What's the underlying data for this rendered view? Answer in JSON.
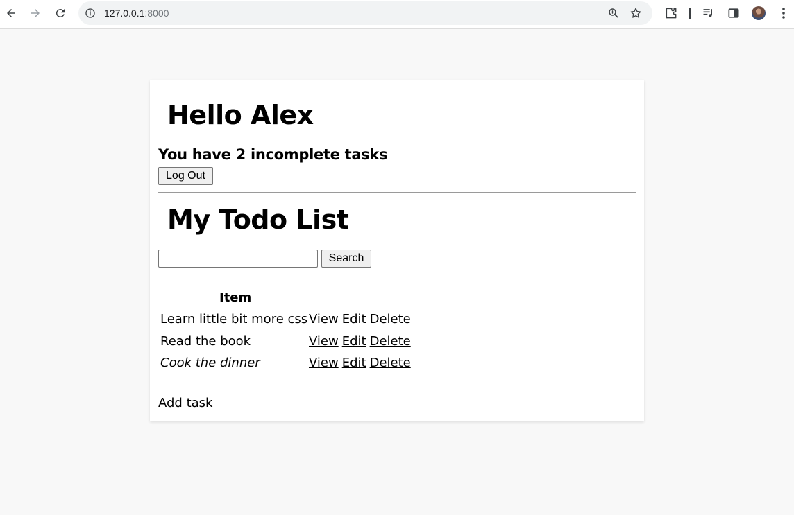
{
  "browser": {
    "url_host": "127.0.0.1",
    "url_port": ":8000",
    "icons": [
      "back-icon",
      "forward-icon",
      "reload-icon",
      "site-info-icon",
      "zoom-icon",
      "bookmark-star-icon",
      "extensions-icon",
      "media-control-icon",
      "side-panel-icon",
      "profile-avatar",
      "menu-dots-icon"
    ]
  },
  "page": {
    "greeting": "Hello Alex",
    "incomplete_summary": "You have 2 incomplete tasks",
    "logout_label": "Log Out",
    "todo_title": "My Todo List",
    "search_value": "",
    "search_label": "Search",
    "table_header": "Item",
    "tasks": [
      {
        "title": "Learn little bit more css",
        "completed": false,
        "view": "View",
        "edit": "Edit",
        "delete": "Delete"
      },
      {
        "title": "Read the book",
        "completed": false,
        "view": "View",
        "edit": "Edit",
        "delete": "Delete"
      },
      {
        "title": "Cook the dinner",
        "completed": true,
        "view": "View",
        "edit": "Edit",
        "delete": "Delete"
      }
    ],
    "add_task_label": "Add task"
  },
  "colors": {
    "page_background": "#f8f8f8",
    "card_background": "#ffffff",
    "button_background": "#efefef"
  }
}
